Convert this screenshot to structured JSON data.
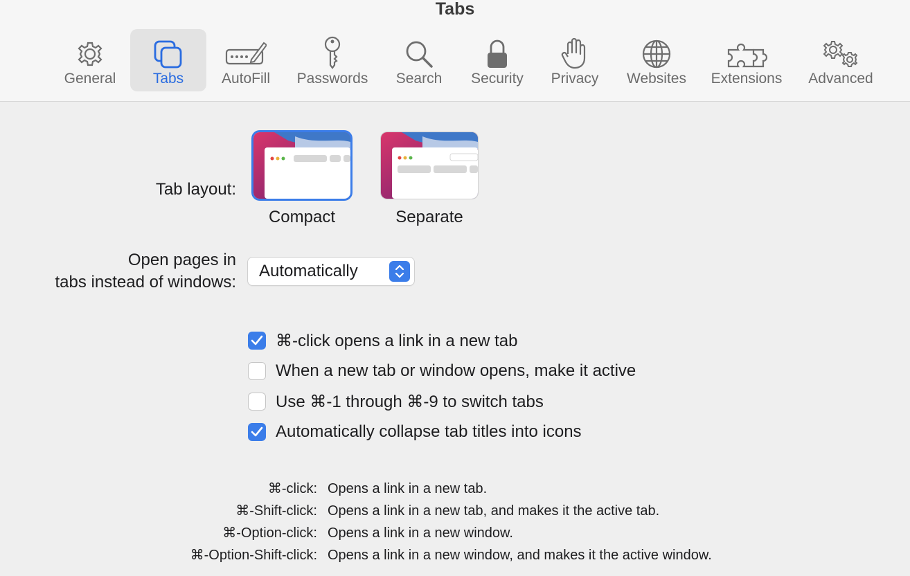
{
  "window": {
    "title": "Tabs"
  },
  "toolbar": {
    "tabs": [
      {
        "label": "General",
        "icon": "gear-icon"
      },
      {
        "label": "Tabs",
        "icon": "tabs-icon",
        "active": true
      },
      {
        "label": "AutoFill",
        "icon": "pencil-field-icon"
      },
      {
        "label": "Passwords",
        "icon": "key-icon"
      },
      {
        "label": "Search",
        "icon": "magnifier-icon"
      },
      {
        "label": "Security",
        "icon": "lock-icon"
      },
      {
        "label": "Privacy",
        "icon": "hand-icon"
      },
      {
        "label": "Websites",
        "icon": "globe-icon"
      },
      {
        "label": "Extensions",
        "icon": "puzzle-icon"
      },
      {
        "label": "Advanced",
        "icon": "gears-icon"
      }
    ]
  },
  "tab_layout": {
    "label": "Tab layout:",
    "options": [
      {
        "caption": "Compact",
        "selected": true
      },
      {
        "caption": "Separate",
        "selected": false
      }
    ]
  },
  "open_pages": {
    "label_line1": "Open pages in",
    "label_line2": "tabs instead of windows:",
    "value": "Automatically"
  },
  "checkboxes": [
    {
      "label": "⌘-click opens a link in a new tab",
      "checked": true
    },
    {
      "label": "When a new tab or window opens, make it active",
      "checked": false
    },
    {
      "label": "Use ⌘-1 through ⌘-9 to switch tabs",
      "checked": false
    },
    {
      "label": "Automatically collapse tab titles into icons",
      "checked": true
    }
  ],
  "shortcuts": [
    {
      "key": "⌘-click:",
      "desc": "Opens a link in a new tab."
    },
    {
      "key": "⌘-Shift-click:",
      "desc": "Opens a link in a new tab, and makes it the active tab."
    },
    {
      "key": "⌘-Option-click:",
      "desc": "Opens a link in a new window."
    },
    {
      "key": "⌘-Option-Shift-click:",
      "desc": "Opens a link in a new window, and makes it the active window."
    }
  ],
  "colors": {
    "accent": "#3b7de9",
    "background": "#efefef",
    "toolbar": "#f6f6f6"
  }
}
